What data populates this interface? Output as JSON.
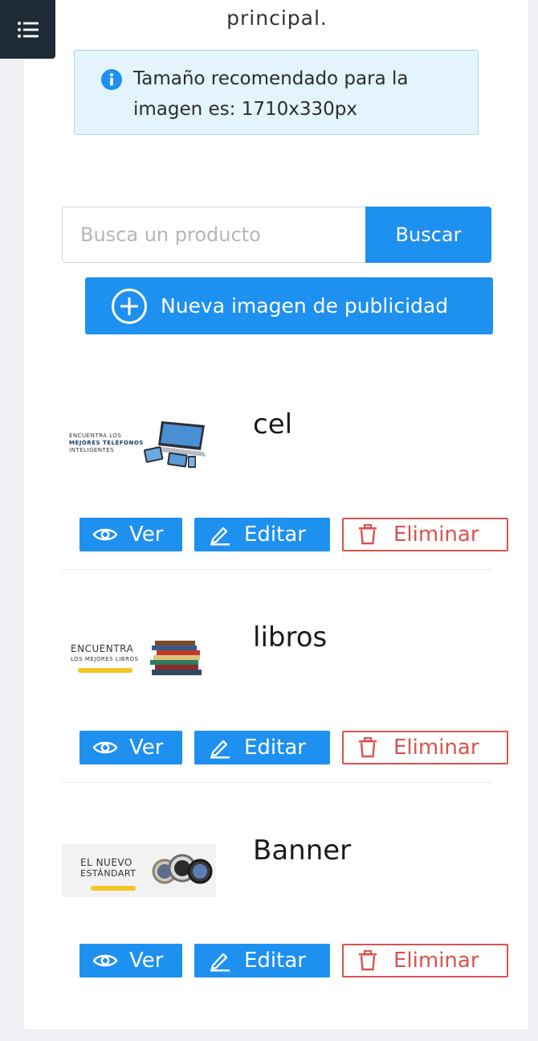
{
  "menu": {
    "icon": "list-icon"
  },
  "intro": {
    "text": "principal."
  },
  "info": {
    "icon": "info-icon",
    "text": "Tamaño recomendado para la imagen es: 1710x330px"
  },
  "search": {
    "placeholder": "Busca un producto",
    "value": "",
    "button_label": "Buscar"
  },
  "new_image": {
    "icon": "plus-circle-icon",
    "label": "Nueva imagen de publicidad"
  },
  "actions": {
    "view_label": "Ver",
    "view_icon": "eye-icon",
    "edit_label": "Editar",
    "edit_icon": "pencil-icon",
    "delete_label": "Eliminar",
    "delete_icon": "trash-icon"
  },
  "items": [
    {
      "name": "cel",
      "thumb_lines": [
        "ENCUENTRA LOS",
        "MEJORES TELÉFONOS",
        "INTELIGENTES"
      ]
    },
    {
      "name": "libros",
      "thumb_lines": [
        "ENCUENTRA",
        "LOS MEJORES LIBROS"
      ]
    },
    {
      "name": "Banner",
      "thumb_lines": [
        "EL NUEVO",
        "ESTÁNDART"
      ]
    }
  ],
  "colors": {
    "primary": "#1e90f0",
    "danger": "#d9534f",
    "info_bg": "#e3f4fd",
    "menu_bg": "#1f2a37"
  }
}
